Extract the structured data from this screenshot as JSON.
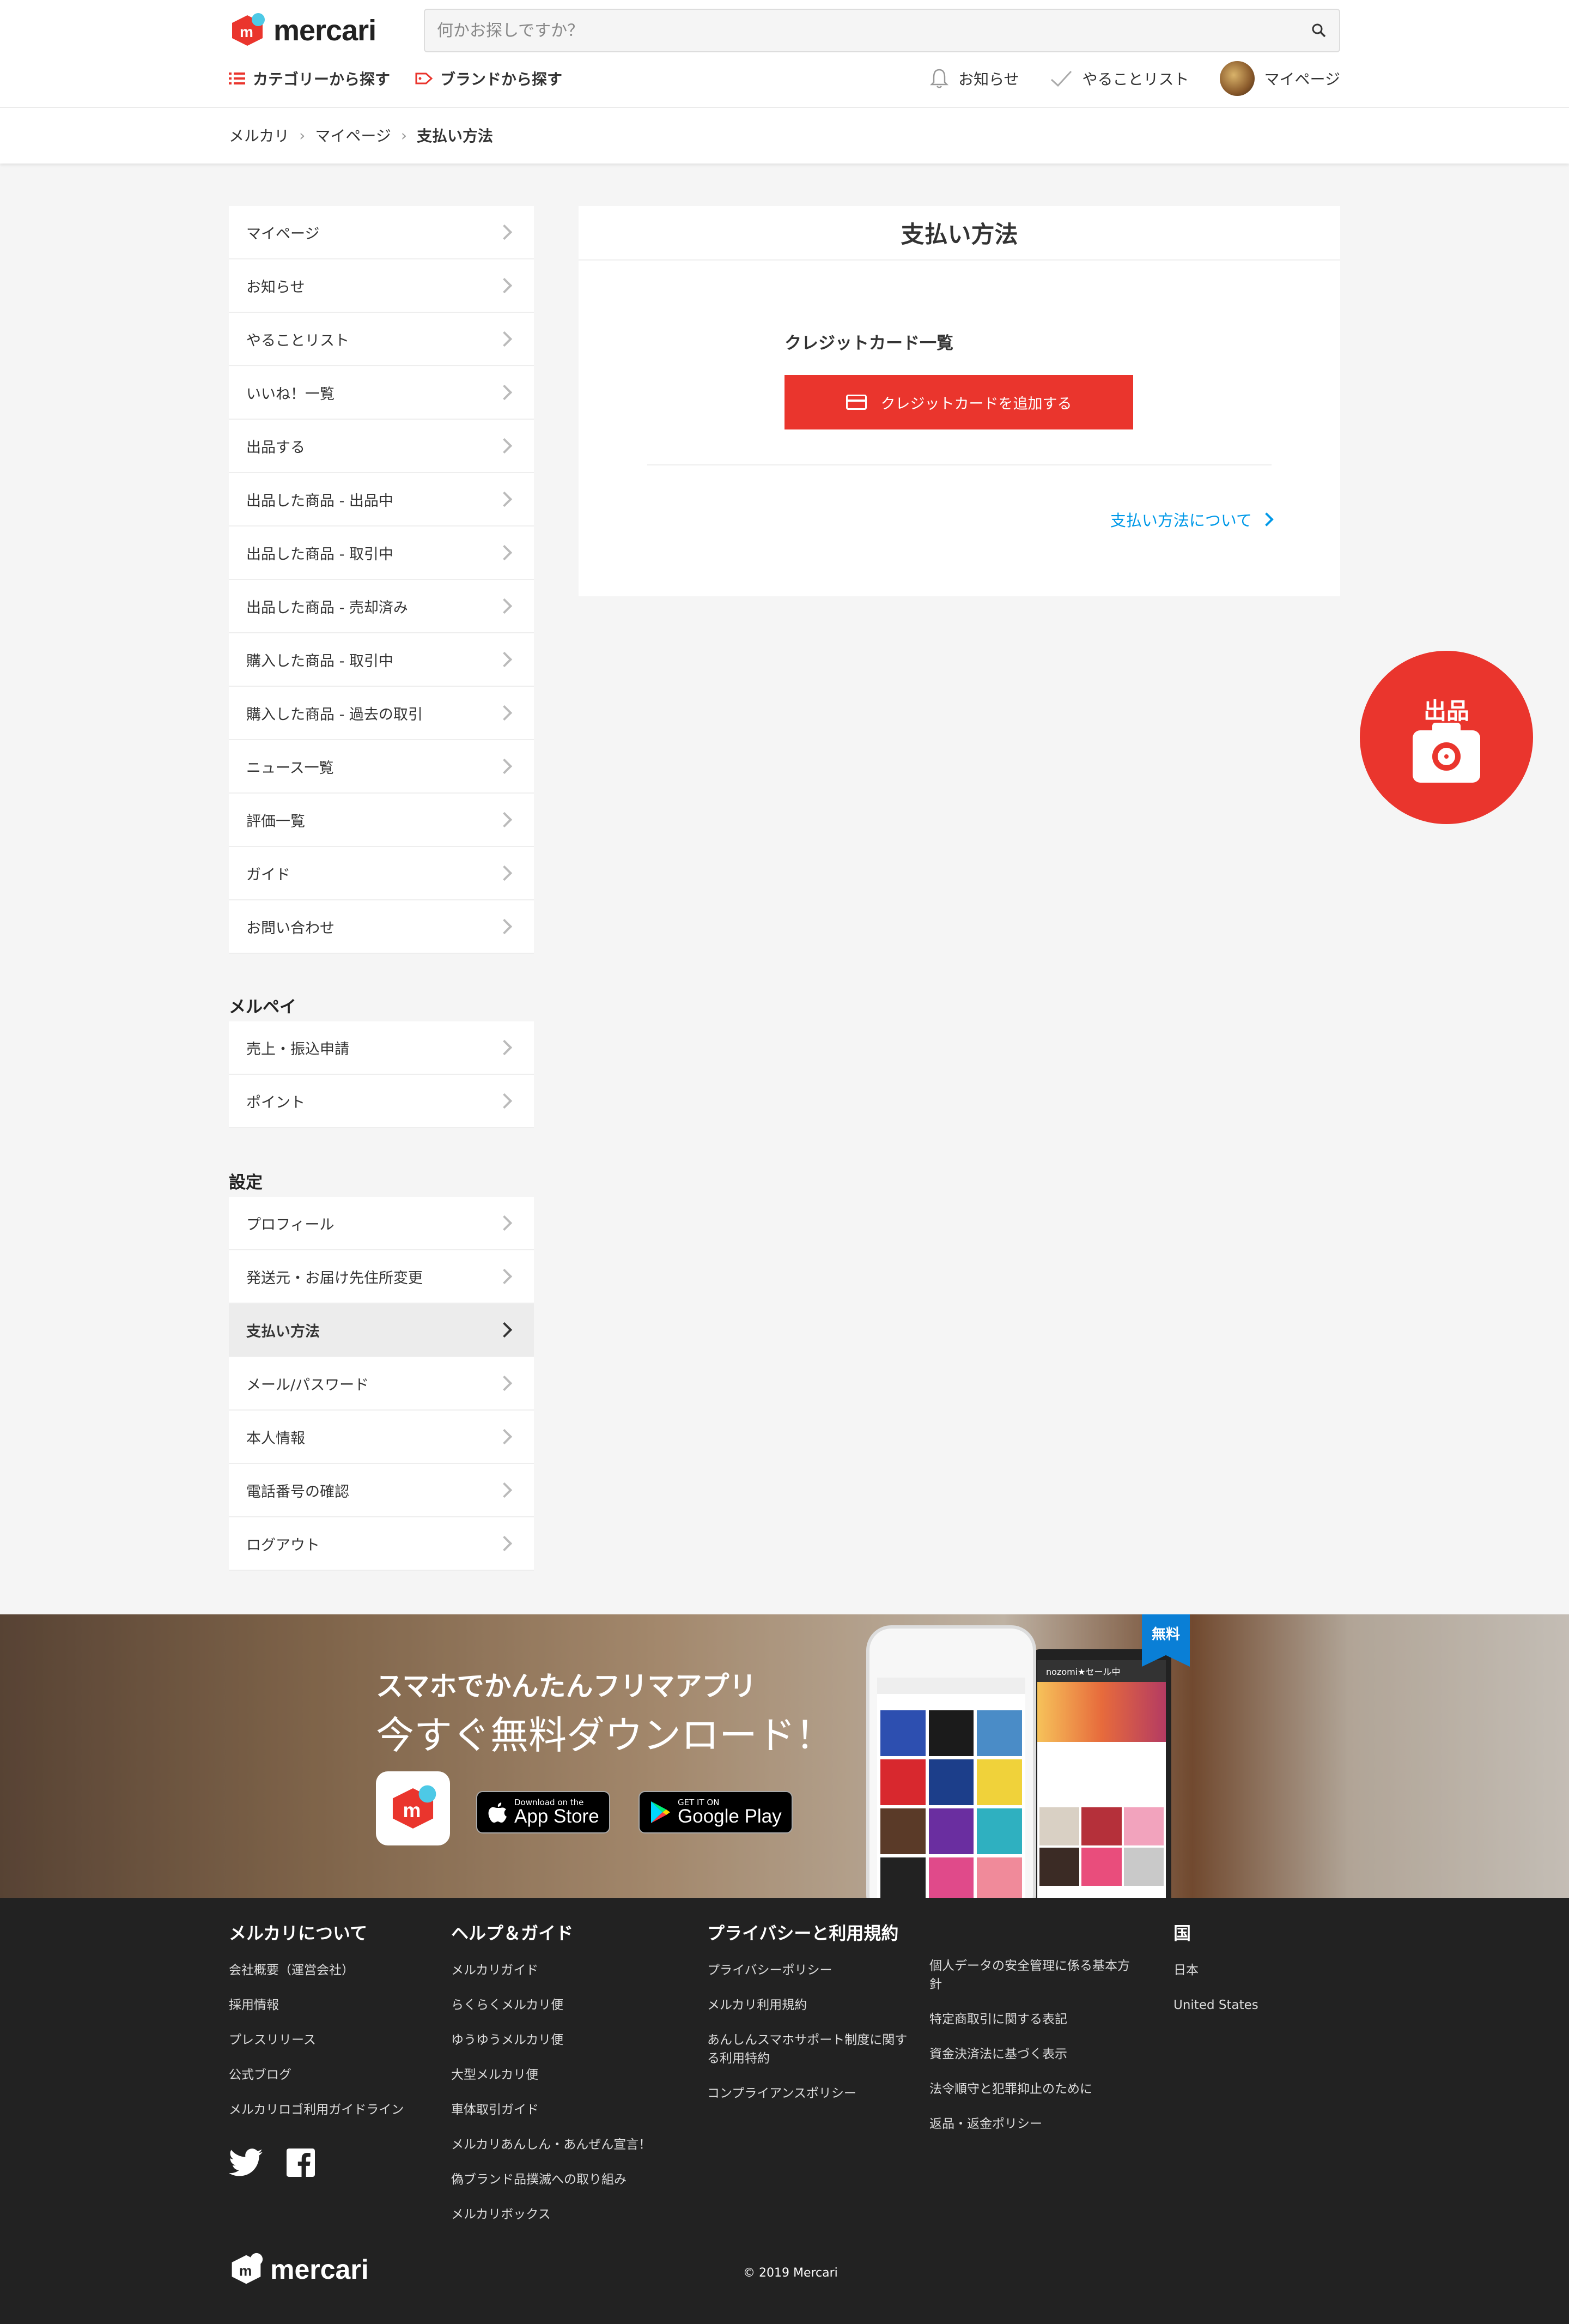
{
  "header": {
    "logo_text": "mercari",
    "search_placeholder": "何かお探しですか？",
    "nav_left": [
      {
        "label": "カテゴリーから探す",
        "icon": "list-icon"
      },
      {
        "label": "ブランドから探す",
        "icon": "tag-icon"
      }
    ],
    "nav_right": [
      {
        "label": "お知らせ",
        "icon": "bell-icon"
      },
      {
        "label": "やることリスト",
        "icon": "check-icon"
      },
      {
        "label": "マイページ",
        "icon": "avatar"
      }
    ]
  },
  "breadcrumb": [
    "メルカリ",
    "マイページ",
    "支払い方法"
  ],
  "sidebar": {
    "main_items": [
      "マイページ",
      "お知らせ",
      "やることリスト",
      "いいね！一覧",
      "出品する",
      "出品した商品 - 出品中",
      "出品した商品 - 取引中",
      "出品した商品 - 売却済み",
      "購入した商品 - 取引中",
      "購入した商品 - 過去の取引",
      "ニュース一覧",
      "評価一覧",
      "ガイド",
      "お問い合わせ"
    ],
    "merpay_heading": "メルペイ",
    "merpay_items": [
      "売上・振込申請",
      "ポイント"
    ],
    "settings_heading": "設定",
    "settings_items": [
      "プロフィール",
      "発送元・お届け先住所変更",
      "支払い方法",
      "メール/パスワード",
      "本人情報",
      "電話番号の確認",
      "ログアウト"
    ],
    "active_item": "支払い方法"
  },
  "main": {
    "title": "支払い方法",
    "card_list_heading": "クレジットカード一覧",
    "add_card_button": "クレジットカードを追加する",
    "about_link": "支払い方法について"
  },
  "fab": {
    "label": "出品",
    "icon": "camera-icon"
  },
  "banner": {
    "line1": "スマホでかんたんフリマアプリ",
    "line2": "今すぐ無料ダウンロード！",
    "badge": "無料",
    "app_store_small": "Download on the",
    "app_store_big": "App Store",
    "google_small": "GET IT ON",
    "google_big": "Google Play",
    "tablet_header": "nozomi★セール中"
  },
  "footer": {
    "col1": {
      "heading": "メルカリについて",
      "links": [
        "会社概要（運営会社）",
        "採用情報",
        "プレスリリース",
        "公式ブログ",
        "メルカリロゴ利用ガイドライン"
      ]
    },
    "col2": {
      "heading": "ヘルプ＆ガイド",
      "links": [
        "メルカリガイド",
        "らくらくメルカリ便",
        "ゆうゆうメルカリ便",
        "大型メルカリ便",
        "車体取引ガイド",
        "メルカリあんしん・あんぜん宣言！",
        "偽ブランド品撲滅への取り組み",
        "メルカリボックス"
      ]
    },
    "col3": {
      "heading": "プライバシーと利用規約",
      "links": [
        "プライバシーポリシー",
        "メルカリ利用規約",
        "あんしんスマホサポート制度に関する利用特約",
        "コンプライアンスポリシー"
      ]
    },
    "col4": {
      "links": [
        "個人データの安全管理に係る基本方針",
        "特定商取引に関する表記",
        "資金決済法に基づく表示",
        "法令順守と犯罪抑止のために",
        "返品・返金ポリシー"
      ]
    },
    "col5": {
      "heading": "国",
      "links": [
        "日本",
        "United States"
      ]
    },
    "social": [
      "twitter-icon",
      "facebook-icon"
    ],
    "logo_text": "mercari",
    "copyright": "© 2019 Mercari"
  },
  "colors": {
    "brand_red": "#ea352d",
    "link_blue": "#0099e8",
    "footer_bg": "#222222",
    "page_bg": "#f5f5f5"
  }
}
